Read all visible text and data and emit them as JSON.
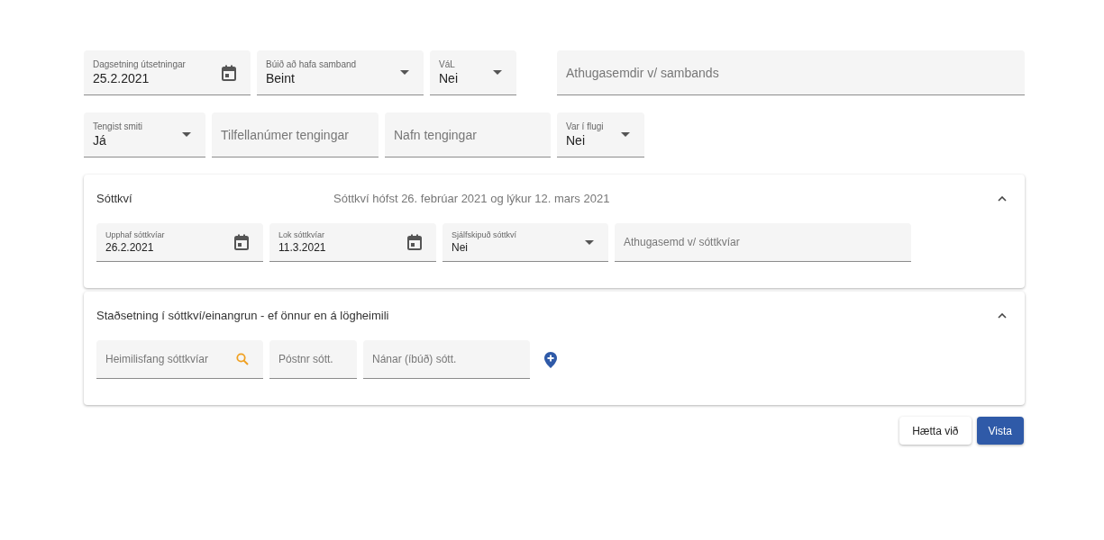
{
  "rows": [
    [
      {
        "kind": "date",
        "label": "Dagsetning útsetningar",
        "value": "25.2.2021"
      },
      {
        "kind": "select",
        "label": "Búið að hafa samband",
        "value": "Beint"
      },
      {
        "kind": "select",
        "label": "VáL",
        "value": "Nei"
      },
      {
        "kind": "text",
        "placeholder": "Athugasemdir v/ sambands"
      }
    ],
    [
      {
        "kind": "select",
        "label": "Tengist smiti",
        "value": "Já"
      },
      {
        "kind": "text",
        "placeholder": "Tilfellanúmer tengingar"
      },
      {
        "kind": "text",
        "placeholder": "Nafn tengingar"
      },
      {
        "kind": "select",
        "label": "Var í flugi",
        "value": "Nei"
      }
    ]
  ],
  "panels": [
    {
      "title": "Sóttkví",
      "summary": "Sóttkví hófst 26. febrúar 2021 og lýkur 12. mars 2021",
      "expanded": true,
      "fields": [
        {
          "kind": "date",
          "label": "Upphaf sóttkvíar",
          "value": "26.2.2021"
        },
        {
          "kind": "date",
          "label": "Lok sóttkvíar",
          "value": "11.3.2021"
        },
        {
          "kind": "select",
          "label": "Sjálfskipuð sóttkví",
          "value": "Nei"
        },
        {
          "kind": "text",
          "placeholder": "Athugasemd v/ sóttkvíar"
        }
      ]
    },
    {
      "title": "Staðsetning í sóttkví/einangrun - ef önnur en á lögheimili",
      "expanded": true,
      "fields": [
        {
          "kind": "search",
          "placeholder": "Heimilisfang sóttkvíar"
        },
        {
          "kind": "text",
          "placeholder": "Póstnr sótt."
        },
        {
          "kind": "text",
          "placeholder": "Nánar (íbúð) sótt."
        }
      ]
    }
  ],
  "buttons": [
    {
      "label": "Hætta við",
      "kind": "secondary"
    },
    {
      "label": "Vista",
      "kind": "primary"
    }
  ]
}
